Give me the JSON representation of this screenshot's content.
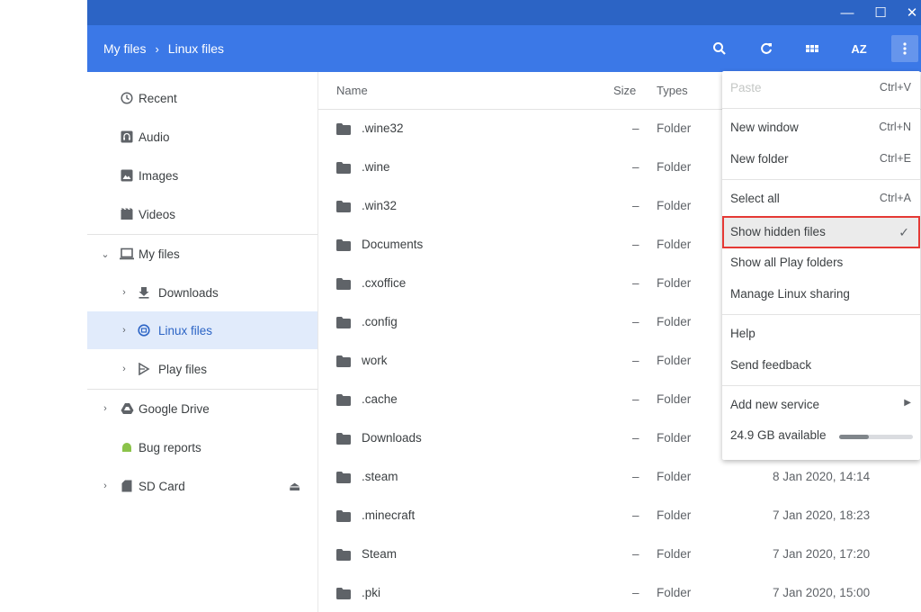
{
  "window": {
    "minimize_glyph": "—",
    "maximize_glyph": "☐",
    "close_glyph": "✕"
  },
  "toolbar": {
    "breadcrumb": [
      "My files",
      "Linux files"
    ],
    "breadcrumb_separator": "›",
    "sort_label": "AZ",
    "icons": [
      "search-icon",
      "refresh-icon",
      "grid-view-icon",
      "sort-icon",
      "more-vert-icon"
    ]
  },
  "sidebar": {
    "items": [
      {
        "label": "Recent",
        "icon": "clock-icon"
      },
      {
        "label": "Audio",
        "icon": "audio-icon"
      },
      {
        "label": "Images",
        "icon": "image-icon"
      },
      {
        "label": "Videos",
        "icon": "video-icon"
      },
      {
        "label": "My files",
        "icon": "laptop-icon",
        "expander": "⌄"
      },
      {
        "label": "Downloads",
        "icon": "download-icon",
        "expander": "›"
      },
      {
        "label": "Linux files",
        "icon": "linux-icon",
        "expander": "›",
        "active": true
      },
      {
        "label": "Play files",
        "icon": "play-icon",
        "expander": "›"
      },
      {
        "label": "Google Drive",
        "icon": "drive-icon",
        "expander": "›"
      },
      {
        "label": "Bug reports",
        "icon": "android-icon"
      },
      {
        "label": "SD Card",
        "icon": "sdcard-icon",
        "expander": "›",
        "eject": "⏏"
      }
    ]
  },
  "list": {
    "headers": {
      "name": "Name",
      "size": "Size",
      "type": "Types"
    },
    "rows": [
      {
        "name": ".wine32",
        "size": "–",
        "type": "Folder",
        "date": ""
      },
      {
        "name": ".wine",
        "size": "–",
        "type": "Folder",
        "date": ""
      },
      {
        "name": ".win32",
        "size": "–",
        "type": "Folder",
        "date": ""
      },
      {
        "name": "Documents",
        "size": "–",
        "type": "Folder",
        "date": ""
      },
      {
        "name": ".cxoffice",
        "size": "–",
        "type": "Folder",
        "date": ""
      },
      {
        "name": ".config",
        "size": "–",
        "type": "Folder",
        "date": ""
      },
      {
        "name": "work",
        "size": "–",
        "type": "Folder",
        "date": ""
      },
      {
        "name": ".cache",
        "size": "–",
        "type": "Folder",
        "date": ""
      },
      {
        "name": "Downloads",
        "size": "–",
        "type": "Folder",
        "date": ""
      },
      {
        "name": ".steam",
        "size": "–",
        "type": "Folder",
        "date": "8 Jan 2020, 14:14"
      },
      {
        "name": ".minecraft",
        "size": "–",
        "type": "Folder",
        "date": "7 Jan 2020, 18:23"
      },
      {
        "name": "Steam",
        "size": "–",
        "type": "Folder",
        "date": "7 Jan 2020, 17:20"
      },
      {
        "name": ".pki",
        "size": "–",
        "type": "Folder",
        "date": "7 Jan 2020, 15:00"
      }
    ]
  },
  "menu": {
    "paste": {
      "label": "Paste",
      "shortcut": "Ctrl+V"
    },
    "new_window": {
      "label": "New window",
      "shortcut": "Ctrl+N"
    },
    "new_folder": {
      "label": "New folder",
      "shortcut": "Ctrl+E"
    },
    "select_all": {
      "label": "Select all",
      "shortcut": "Ctrl+A"
    },
    "show_hidden": {
      "label": "Show hidden files",
      "check": "✓"
    },
    "show_play": {
      "label": "Show all Play folders"
    },
    "manage_linux": {
      "label": "Manage Linux sharing"
    },
    "help": {
      "label": "Help"
    },
    "feedback": {
      "label": "Send feedback"
    },
    "add_service": {
      "label": "Add new service",
      "arrow": "▶"
    },
    "storage": {
      "label": "24.9 GB available",
      "used_fraction": 0.4
    }
  },
  "colors": {
    "title": "#2c64c5",
    "toolbar": "#3b78e7",
    "active_bg": "#e1ebfb",
    "highlight_border": "#e53935"
  }
}
